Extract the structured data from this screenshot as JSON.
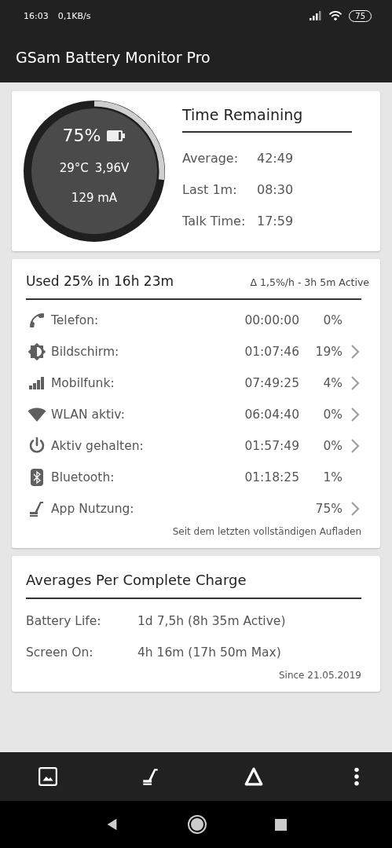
{
  "status_bar": {
    "time": "16:03",
    "speed": "0,1KB/s",
    "battery": "75"
  },
  "app_bar": {
    "title": "GSam Battery Monitor Pro"
  },
  "gauge": {
    "percent": "75%",
    "temp": "29°C",
    "voltage": "3,96V",
    "current": "129 mA"
  },
  "time_remaining": {
    "title": "Time Remaining",
    "rows": [
      {
        "label": "Average:",
        "value": "42:49"
      },
      {
        "label": "Last 1m:",
        "value": "08:30"
      },
      {
        "label": "Talk Time:",
        "value": "17:59"
      }
    ]
  },
  "usage": {
    "title": "Used 25% in 16h 23m",
    "rate": "Δ 1,5%/h - 3h 5m Active",
    "rows": [
      {
        "kind": "phone",
        "label": "Telefon:",
        "time": "00:00:00",
        "percent": "0%",
        "chevron": false
      },
      {
        "kind": "screen",
        "label": "Bildschirm:",
        "time": "01:07:46",
        "percent": "19%",
        "chevron": true
      },
      {
        "kind": "cell",
        "label": "Mobilfunk:",
        "time": "07:49:25",
        "percent": "4%",
        "chevron": true
      },
      {
        "kind": "wifi",
        "label": "WLAN aktiv:",
        "time": "06:04:40",
        "percent": "0%",
        "chevron": true
      },
      {
        "kind": "power",
        "label": "Aktiv gehalten:",
        "time": "01:57:49",
        "percent": "0%",
        "chevron": true
      },
      {
        "kind": "bluetooth",
        "label": "Bluetooth:",
        "time": "01:18:25",
        "percent": "1%",
        "chevron": false
      },
      {
        "kind": "app",
        "label": "App Nutzung:",
        "percent": "75%",
        "chevron": true
      }
    ],
    "footnote": "Seit dem letzten vollständigen Aufladen"
  },
  "averages": {
    "title": "Averages Per Complete Charge",
    "rows": [
      {
        "label": "Battery Life:",
        "value": "1d 7,5h (8h 35m Active)"
      },
      {
        "label": "Screen On:",
        "value": "4h 16m (17h 50m Max)"
      }
    ],
    "footnote": "Since 21.05.2019"
  },
  "bottom_bar": [
    {
      "kind": "picture"
    },
    {
      "kind": "app"
    },
    {
      "kind": "delta"
    },
    {
      "kind": "more"
    }
  ],
  "nav_bar": [
    {
      "kind": "back"
    },
    {
      "kind": "home"
    },
    {
      "kind": "recents"
    }
  ]
}
